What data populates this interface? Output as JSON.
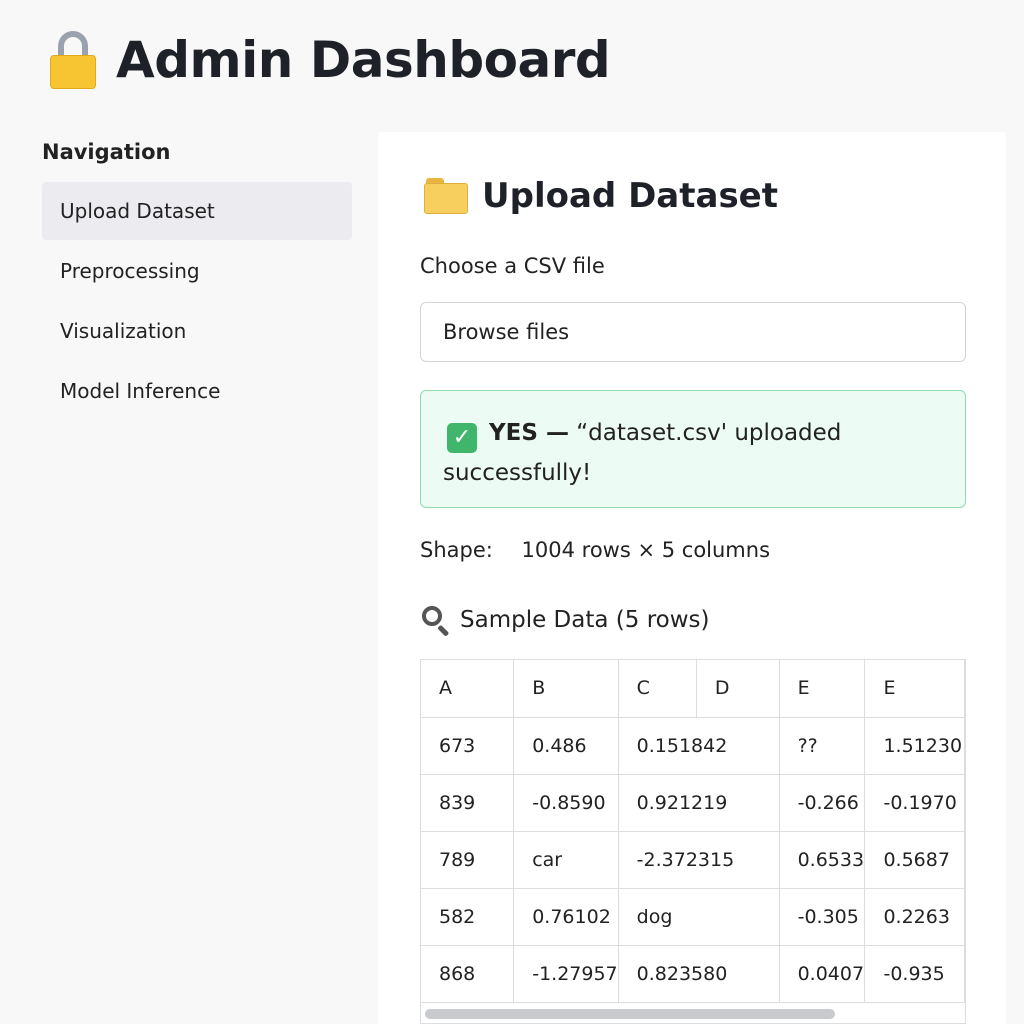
{
  "header": {
    "title": "Admin Dashboard",
    "icon": "lock-icon"
  },
  "sidebar": {
    "heading": "Navigation",
    "items": [
      {
        "label": "Upload Dataset",
        "active": true
      },
      {
        "label": "Preprocessing",
        "active": false
      },
      {
        "label": "Visualization",
        "active": false
      },
      {
        "label": "Model Inference",
        "active": false
      }
    ]
  },
  "main": {
    "section_title": "Upload Dataset",
    "section_icon": "folder-icon",
    "file_label": "Choose a CSV file",
    "browse_label": "Browse files",
    "alert": {
      "strong": "YES —",
      "message": "“dataset.csv' uploaded successfully!",
      "icon": "check-icon",
      "color": "#3fb66c"
    },
    "shape": {
      "label": "Shape:",
      "value": "1004 rows × 5 columns"
    },
    "sample_title": "Sample Data (5 rows)",
    "table": {
      "headers": [
        "A",
        "B",
        "C",
        "D",
        "E",
        "E"
      ],
      "rows": [
        [
          "673",
          "0.486",
          "0.151842",
          "",
          "??",
          "1.51230"
        ],
        [
          "839",
          "-0.8590",
          "0.921219",
          "",
          "-0.266",
          "-0.1970"
        ],
        [
          "789",
          "car",
          "-2.372315",
          "",
          "0.6533",
          "0.5687"
        ],
        [
          "582",
          "0.76102",
          "dog",
          "",
          "-0.305",
          "0.2263"
        ],
        [
          "868",
          "-1.27957",
          "0.823580",
          "",
          "0.0407",
          "-0.935"
        ]
      ]
    }
  }
}
